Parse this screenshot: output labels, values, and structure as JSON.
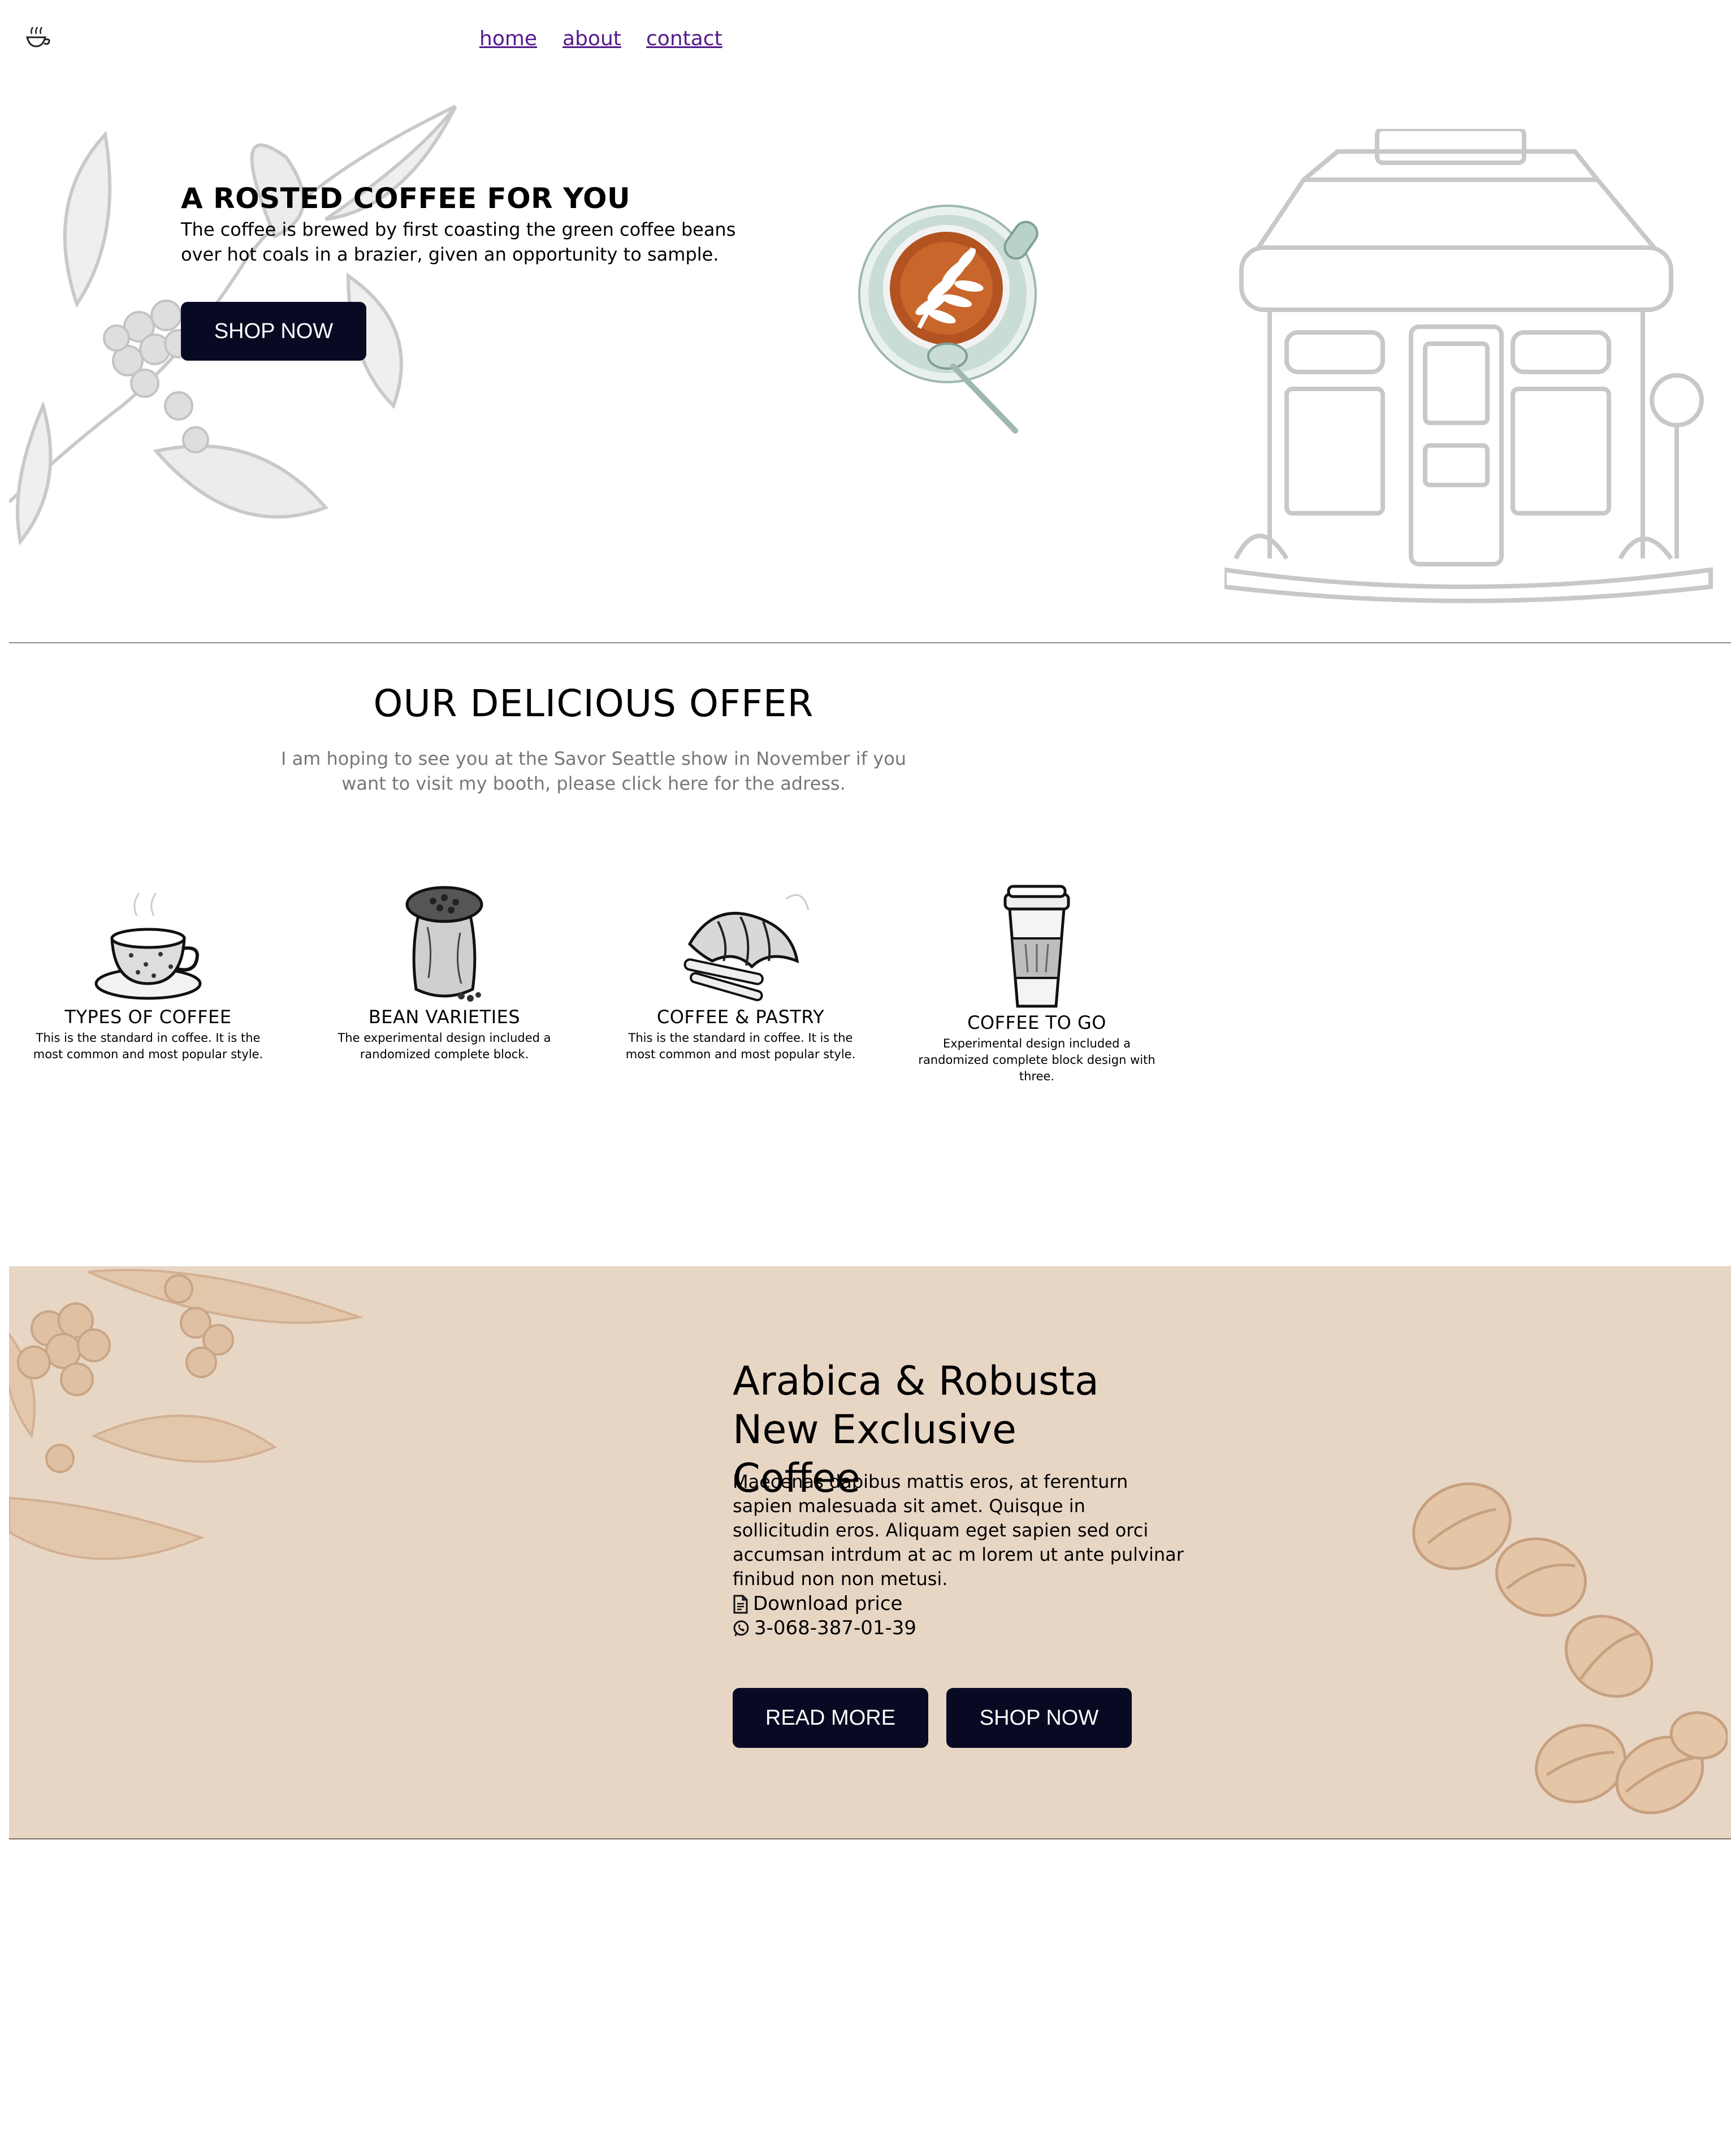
{
  "nav": {
    "items": [
      "home",
      "about",
      "contact"
    ]
  },
  "hero": {
    "title": "A ROSTED COFFEE FOR YOU",
    "text": "The coffee is brewed by first coasting the green coffee beans over hot coals in a brazier, given an opportunity to sample.",
    "button": "SHOP NOW"
  },
  "offer": {
    "title": "OUR DELICIOUS OFFER",
    "subtitle": "I am hoping to see you at the Savor Seattle show in November if you want to visit my booth, please click here for the adress.",
    "cards": [
      {
        "title": "TYPES OF COFFEE",
        "text": "This is the standard in coffee. It is the most common and most popular style.",
        "icon": "coffee-cup-icon"
      },
      {
        "title": "BEAN VARIETIES",
        "text": "The experimental design included a randomized complete block.",
        "icon": "bean-sack-icon"
      },
      {
        "title": "COFFEE & PASTRY",
        "text": "This is the standard in coffee. It is the most common and most popular style.",
        "icon": "croissant-icon"
      },
      {
        "title": "COFFEE TO GO",
        "text": "Experimental design included a randomized complete block design with three.",
        "icon": "to-go-cup-icon"
      }
    ]
  },
  "promo": {
    "title": "Arabica & Robusta New Exclusive Coffee",
    "text": "Maecenas dapibus mattis eros, at ferenturn sapien malesuada sit amet. Quisque in sollicitudin eros. Aliquam eget sapien sed orci accumsan intrdum at ac m lorem ut ante pulvinar finibud non non metusi.",
    "download": "Download price",
    "phone": "3-068-387-01-39",
    "read_more": "READ MORE",
    "shop_now": "SHOP NOW"
  },
  "colors": {
    "button": "#070a22",
    "promo_bg": "#e8d6c5",
    "link": "#551a8b",
    "muted": "#777777"
  }
}
